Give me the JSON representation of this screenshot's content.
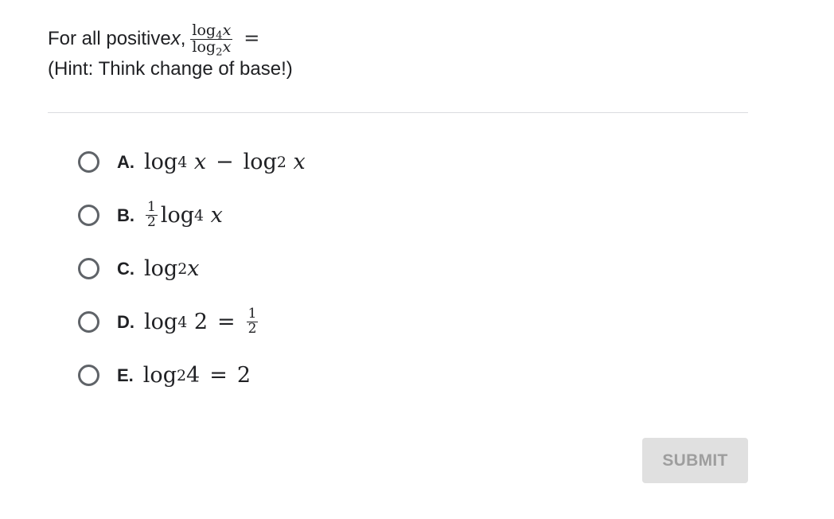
{
  "question": {
    "prefix": "For all positive ",
    "variable": "x",
    "comma": ",",
    "fraction": {
      "num_log": "log",
      "num_base": "4",
      "num_var": "x",
      "den_log": "log",
      "den_base": "2",
      "den_var": "x"
    },
    "equals": "=",
    "hint": "(Hint: Think change of base!)"
  },
  "options": [
    {
      "letter": "A.",
      "parts": {
        "log1": "log",
        "base1": "4",
        "var1": "x",
        "op": "−",
        "log2": "log",
        "base2": "2",
        "var2": "x"
      }
    },
    {
      "letter": "B.",
      "parts": {
        "num": "1",
        "den": "2",
        "log": "log",
        "base": "4",
        "var": "x"
      }
    },
    {
      "letter": "C.",
      "parts": {
        "log": "log",
        "base": "2",
        "var": "x"
      }
    },
    {
      "letter": "D.",
      "parts": {
        "log": "log",
        "base": "4",
        "arg": "2",
        "op": "=",
        "num": "1",
        "den": "2"
      }
    },
    {
      "letter": "E.",
      "parts": {
        "log": "log",
        "base": "2",
        "arg": "4",
        "op": "=",
        "rhs": "2"
      }
    }
  ],
  "submit_label": "SUBMIT"
}
